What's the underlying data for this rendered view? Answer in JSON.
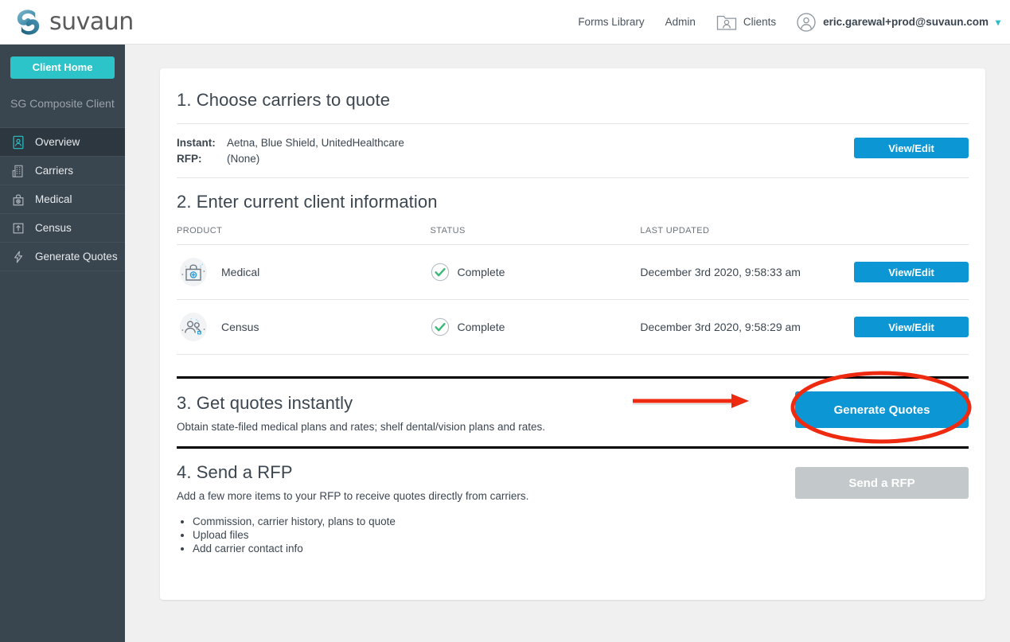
{
  "brand": {
    "name": "suvaun",
    "teal": "#2cc3c9",
    "blue": "#0d96d4",
    "sidebar_bg": "#39454f",
    "annotation_red": "#ee2b10",
    "status_green": "#3cb878",
    "disabled_gray": "#c3c8ca"
  },
  "topnav": {
    "forms_library": "Forms Library",
    "admin": "Admin",
    "clients": "Clients",
    "user_email": "eric.garewal+prod@suvaun.com"
  },
  "sidebar": {
    "client_home": "Client Home",
    "client_name": "SG Composite Client",
    "items": [
      {
        "label": "Overview",
        "icon": "id-badge-icon",
        "active": true
      },
      {
        "label": "Carriers",
        "icon": "building-icon",
        "active": false
      },
      {
        "label": "Medical",
        "icon": "medical-bag-icon",
        "active": false
      },
      {
        "label": "Census",
        "icon": "upload-box-icon",
        "active": false
      },
      {
        "label": "Generate Quotes",
        "icon": "lightning-bolt-icon",
        "active": false
      }
    ]
  },
  "section1": {
    "title": "1. Choose carriers to quote",
    "instant_label": "Instant:",
    "instant_value": "Aetna, Blue Shield, UnitedHealthcare",
    "rfp_label": "RFP:",
    "rfp_value": "(None)",
    "button": "View/Edit"
  },
  "section2": {
    "title": "2. Enter current client information",
    "columns": [
      "PRODUCT",
      "STATUS",
      "LAST UPDATED",
      ""
    ],
    "rows": [
      {
        "product": "Medical",
        "icon": "medical-bag-icon",
        "status": "Complete",
        "last_updated": "December 3rd 2020, 9:58:33 am",
        "button": "View/Edit"
      },
      {
        "product": "Census",
        "icon": "people-group-icon",
        "status": "Complete",
        "last_updated": "December 3rd 2020, 9:58:29 am",
        "button": "View/Edit"
      }
    ]
  },
  "section3": {
    "title": "3. Get quotes instantly",
    "description": "Obtain state-filed medical plans and rates; shelf dental/vision plans and rates.",
    "button": "Generate Quotes"
  },
  "section4": {
    "title": "4. Send a RFP",
    "description": "Add a few more items to your RFP to receive quotes directly from carriers.",
    "bullets": [
      "Commission, carrier history, plans to quote",
      "Upload files",
      "Add carrier contact info"
    ],
    "button": "Send a RFP"
  }
}
